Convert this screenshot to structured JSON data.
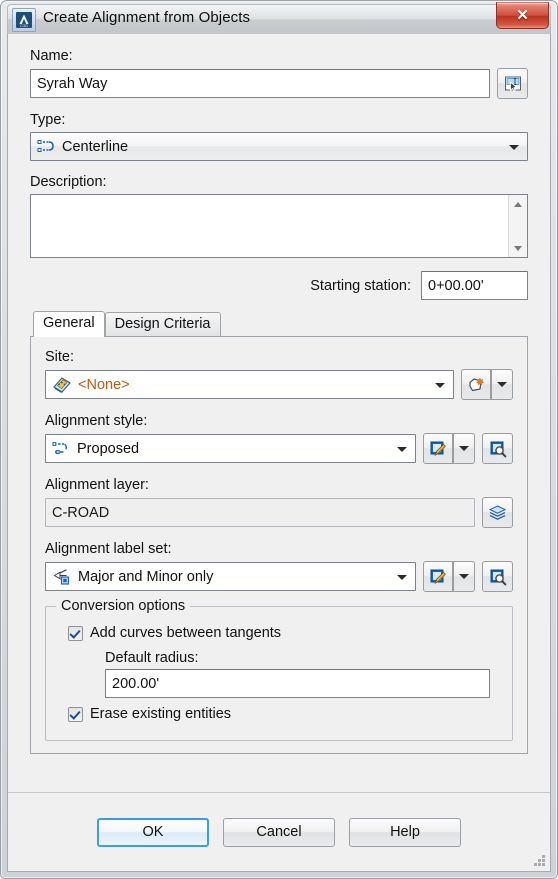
{
  "window": {
    "title": "Create Alignment from Objects",
    "app_icon": "autodesk-civil3d-icon",
    "close_label": "✕"
  },
  "form": {
    "name": {
      "label": "Name:",
      "value": "Syrah Way",
      "placeholder": "",
      "picker_icon": "pick-name-template-icon"
    },
    "type": {
      "label": "Type:",
      "value": "Centerline",
      "icon": "centerline-icon"
    },
    "description": {
      "label": "Description:",
      "value": "",
      "placeholder": ""
    },
    "starting_station": {
      "label": "Starting station:",
      "value": "0+00.00'"
    }
  },
  "tabs": [
    {
      "label": "General",
      "active": true
    },
    {
      "label": "Design Criteria",
      "active": false
    }
  ],
  "general": {
    "site": {
      "label": "Site:",
      "value": "<None>",
      "icon": "site-icon",
      "value_color": "#c05a12",
      "new_button_icon": "new-site-icon",
      "dropdown_icon": "chevron-down-icon"
    },
    "alignment_style": {
      "label": "Alignment style:",
      "value": "Proposed",
      "icon": "alignment-style-icon",
      "edit_icon": "edit-pencil-icon",
      "dropdown_icon": "chevron-down-icon",
      "preview_icon": "preview-magnifier-icon"
    },
    "alignment_layer": {
      "label": "Alignment layer:",
      "value": "C-ROAD",
      "layer_icon": "layers-icon"
    },
    "alignment_label_set": {
      "label": "Alignment label set:",
      "value": "Major and Minor only",
      "icon": "label-set-icon",
      "edit_icon": "edit-pencil-icon",
      "dropdown_icon": "chevron-down-icon",
      "preview_icon": "preview-magnifier-icon"
    },
    "conversion_options": {
      "title": "Conversion options",
      "add_curves": {
        "label": "Add curves between tangents",
        "checked": true
      },
      "default_radius": {
        "label": "Default radius:",
        "value": "200.00'"
      },
      "erase_existing": {
        "label": "Erase existing entities",
        "checked": true
      }
    }
  },
  "footer": {
    "ok": "OK",
    "cancel": "Cancel",
    "help": "Help"
  },
  "colors": {
    "accent": "#3c9ede",
    "site_value": "#c05a12",
    "close_red": "#cf4f3b"
  }
}
